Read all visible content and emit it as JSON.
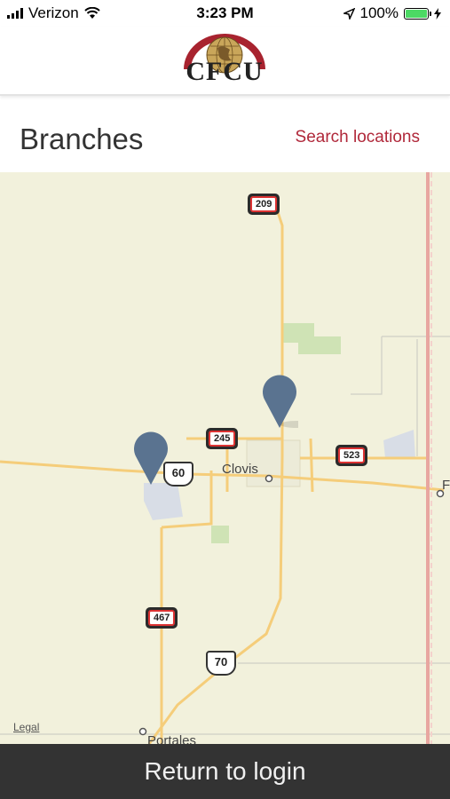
{
  "status_bar": {
    "carrier": "Verizon",
    "time": "3:23 PM",
    "battery": "100%"
  },
  "header": {
    "logo_text": "CFCU"
  },
  "page": {
    "title": "Branches",
    "search_link": "Search locations"
  },
  "map": {
    "place_labels": {
      "clovis": "Clovis",
      "portales": "Portales",
      "partial_right": "F"
    },
    "route_labels": {
      "r209": "209",
      "r245": "245",
      "r523": "523",
      "r467": "467",
      "us60": "60",
      "us70": "70"
    },
    "legal": "Legal",
    "pin_color": "#5a7390",
    "background_color": "#f2f1dc",
    "road_color": "#f5cd7a"
  },
  "bottom_bar": {
    "label": "Return to login"
  },
  "colors": {
    "accent": "#b0283a",
    "bottom_bar": "#333333"
  }
}
